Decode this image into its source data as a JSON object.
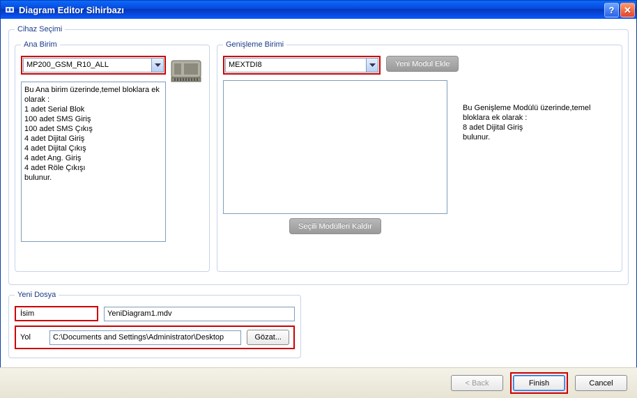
{
  "window": {
    "title": "Diagram Editor Sihirbazı"
  },
  "device_selection": {
    "legend": "Cihaz Seçimi",
    "main_unit": {
      "legend": "Ana Birim",
      "selected": "MP200_GSM_R10_ALL",
      "description": "Bu Ana birim üzerinde,temel bloklara ek olarak :\n 1 adet Serial Blok\n 100 adet SMS Giriş\n 100 adet SMS Çıkış\n 4 adet Dijital Giriş\n 4 adet Dijital Çıkış\n 4 adet Ang. Giriş\n 4 adet Röle Çıkışı\nbulunur."
    },
    "expansion_unit": {
      "legend": "Genişleme Birimi",
      "selected": "MEXTDI8",
      "add_button": "Yeni Modul Ekle",
      "remove_button": "Seçili Modülleri Kaldır",
      "description": "Bu Genişleme Modülü üzerinde,temel bloklara ek olarak :\n 8 adet Dijital Giriş\nbulunur."
    }
  },
  "new_file": {
    "legend": "Yeni Dosya",
    "name_label": "İsim",
    "name_value": "YeniDiagram1.mdv",
    "path_label": "Yol",
    "path_value": "C:\\Documents and Settings\\Administrator\\Desktop",
    "browse_button": "Gözat..."
  },
  "buttons": {
    "back": "< Back",
    "finish": "Finish",
    "cancel": "Cancel"
  }
}
